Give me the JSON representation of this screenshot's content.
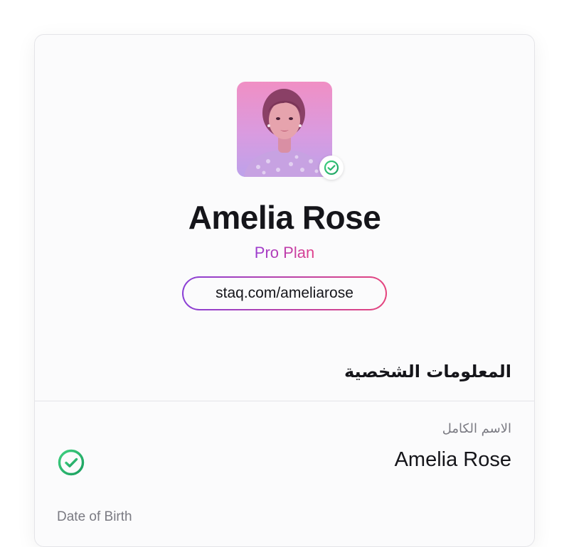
{
  "profile": {
    "name": "Amelia Rose",
    "plan": "Pro Plan",
    "link": "staq.com/ameliarose",
    "verified_icon": "check-circle-icon"
  },
  "colors": {
    "accent_purple": "#9a3bd0",
    "accent_pink": "#e0408a",
    "success_green": "#22b36a"
  },
  "personal_info": {
    "title": "المعلومات الشخصية",
    "fields": [
      {
        "label": "الاسم الكامل",
        "value": "Amelia Rose",
        "status_icon": "check-circle-icon"
      },
      {
        "label": "Date of Birth"
      }
    ]
  }
}
